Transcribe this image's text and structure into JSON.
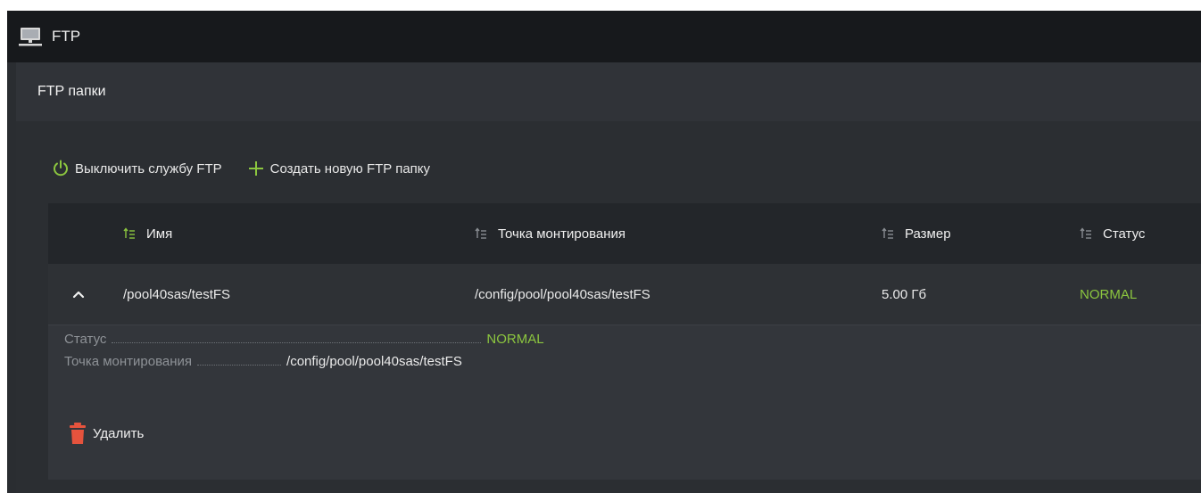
{
  "window": {
    "title": "FTP",
    "icon": "computer-network-icon"
  },
  "panel": {
    "title": "FTP папки"
  },
  "toolbar": {
    "disable_service_label": "Выключить службу FTP",
    "create_folder_label": "Создать новую FTP папку",
    "disable_icon": "power-icon",
    "create_icon": "plus-icon"
  },
  "table": {
    "columns": [
      "Имя",
      "Точка монтирования",
      "Размер",
      "Статус"
    ],
    "rows": [
      {
        "name": "/pool40sas/testFS",
        "mount_point": "/config/pool/pool40sas/testFS",
        "size": "5.00 Гб",
        "status": "NORMAL"
      }
    ]
  },
  "details": {
    "status_label": "Статус",
    "status_value": "NORMAL",
    "mount_label": "Точка монтирования",
    "mount_value": "/config/pool/pool40sas/testFS",
    "delete_label": "Удалить"
  },
  "colors": {
    "accent_green": "#8cc63f",
    "delete_red": "#e5533d",
    "header_bg": "#17191c",
    "panel_bg": "#2b2e32"
  }
}
